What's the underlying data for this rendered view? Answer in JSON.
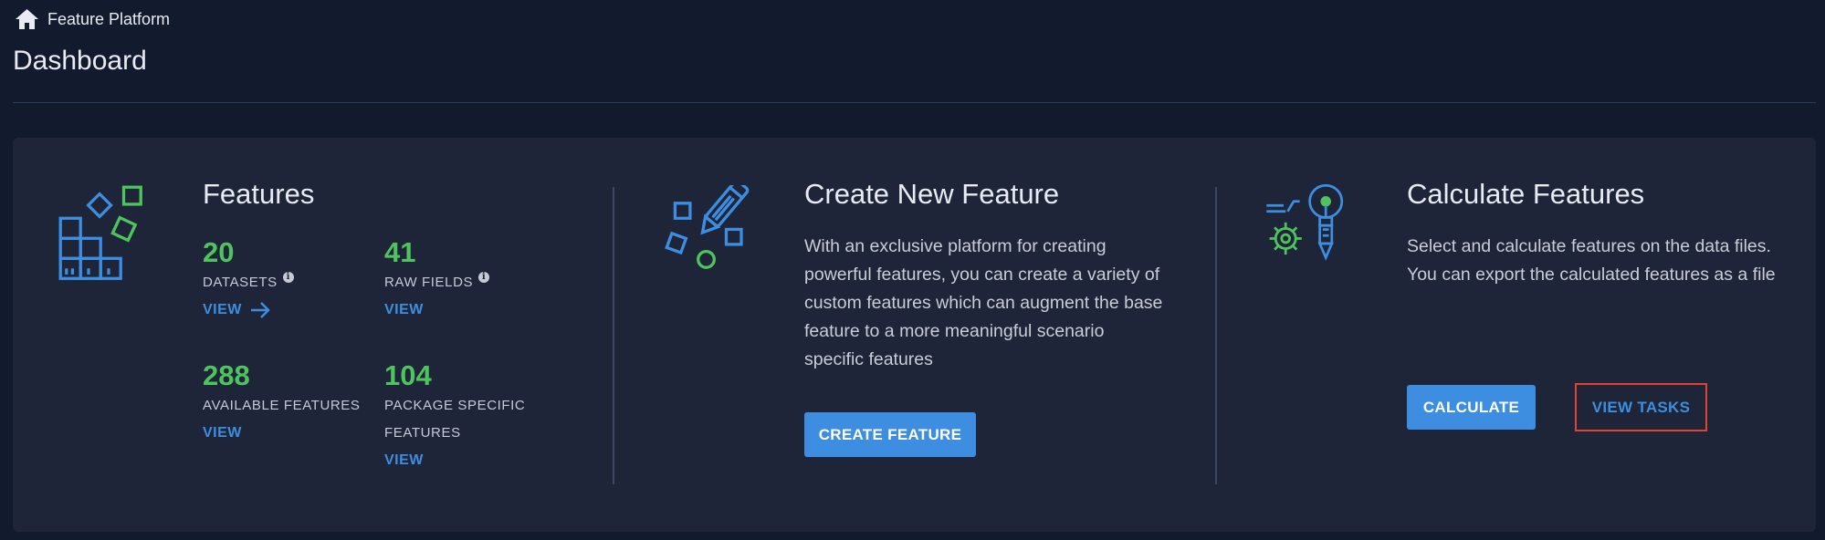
{
  "breadcrumb": {
    "icon": "home-icon",
    "label": "Feature Platform"
  },
  "page": {
    "title": "Dashboard"
  },
  "features": {
    "icon": "blocks-icon",
    "title": "Features",
    "stats": [
      {
        "value": "20",
        "label": "DATASETS",
        "has_info": true,
        "link": "VIEW",
        "link_icon": "arrow-right-icon"
      },
      {
        "value": "41",
        "label": "RAW FIELDS",
        "has_info": true,
        "link": "VIEW"
      },
      {
        "value": "288",
        "label": "AVAILABLE FEATURES",
        "link": "VIEW"
      },
      {
        "value": "104",
        "label_line1": "PACKAGE SPECIFIC",
        "label_line2": "FEATURES",
        "link": "VIEW"
      }
    ]
  },
  "create": {
    "icon": "pencil-shapes-icon",
    "title": "Create New Feature",
    "description": "With an exclusive platform for creating powerful features, you can create a variety of custom features which can augment the base feature to a more meaningful scenario specific features",
    "button": "CREATE FEATURE"
  },
  "calculate": {
    "icon": "gear-bulb-icon",
    "title": "Calculate Features",
    "description": "Select and calculate features on the data files. You can export the calculated features as a file",
    "primary_button": "CALCULATE",
    "secondary_button": "VIEW TASKS"
  },
  "colors": {
    "background": "#121a2e",
    "panel": "#1e2538",
    "accent_blue": "#3d8ee0",
    "stat_green": "#4fc45e",
    "highlight_red": "#e2442f"
  }
}
